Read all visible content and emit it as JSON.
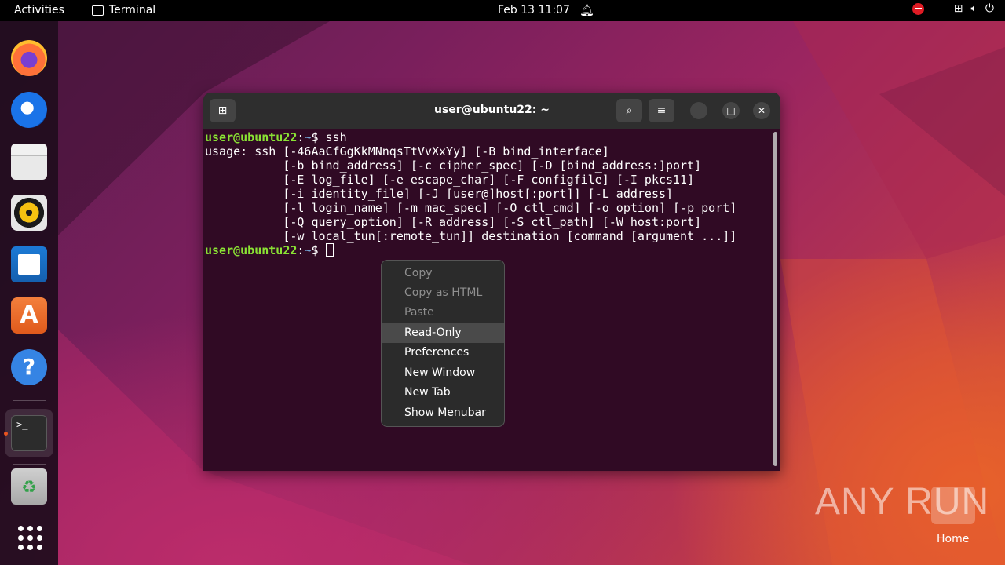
{
  "topbar": {
    "activities": "Activities",
    "app_name": "Terminal",
    "clock": "Feb 13  11:07",
    "icons": [
      "bell-icon",
      "recording-icon",
      "network-icon",
      "volume-icon",
      "power-icon"
    ]
  },
  "dock": {
    "items": [
      "firefox",
      "thunderbird",
      "files",
      "rhythmbox",
      "libreoffice-writer",
      "ubuntu-software",
      "help",
      "terminal",
      "trash",
      "show-applications"
    ]
  },
  "window": {
    "title": "user@ubuntu22: ~",
    "lines": [
      {
        "user": "user@ubuntu22",
        "sep": ":",
        "path": "~",
        "tail": "$ ssh"
      },
      {
        "text": "usage: ssh [-46AaCfGgKkMNnqsTtVvXxYy] [-B bind_interface]"
      },
      {
        "text": "           [-b bind_address] [-c cipher_spec] [-D [bind_address:]port]"
      },
      {
        "text": "           [-E log_file] [-e escape_char] [-F configfile] [-I pkcs11]"
      },
      {
        "text": "           [-i identity_file] [-J [user@]host[:port]] [-L address]"
      },
      {
        "text": "           [-l login_name] [-m mac_spec] [-O ctl_cmd] [-o option] [-p port]"
      },
      {
        "text": "           [-Q query_option] [-R address] [-S ctl_path] [-W host:port]"
      },
      {
        "text": "           [-w local_tun[:remote_tun]] destination [command [argument ...]]"
      },
      {
        "user": "user@ubuntu22",
        "sep": ":",
        "path": "~",
        "tail": "$ "
      }
    ]
  },
  "context_menu": {
    "copy": "Copy",
    "copy_html": "Copy as HTML",
    "paste": "Paste",
    "read_only": "Read-Only",
    "preferences": "Preferences",
    "new_window": "New Window",
    "new_tab": "New Tab",
    "show_menubar": "Show Menubar"
  },
  "desktop": {
    "watermark": "ANY RUN",
    "home_label": "Home"
  }
}
